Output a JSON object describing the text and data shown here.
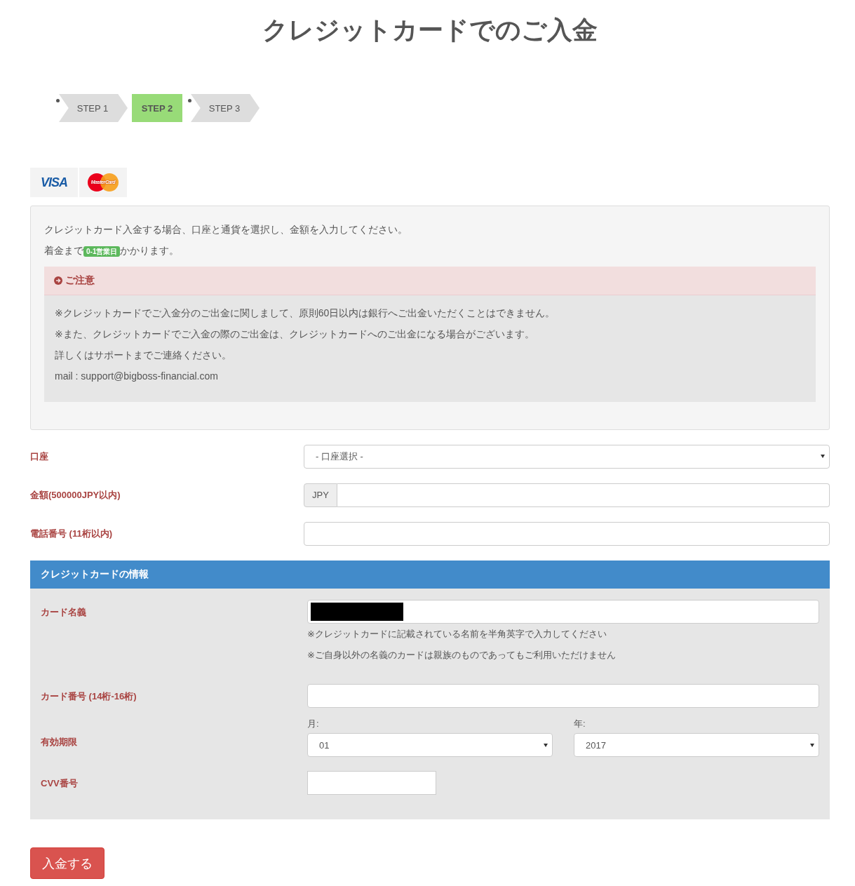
{
  "title": "クレジットカードでのご入金",
  "steps": [
    {
      "label": "STEP 1",
      "selected": false
    },
    {
      "label": "STEP 2",
      "selected": true
    },
    {
      "label": "STEP 3",
      "selected": false
    }
  ],
  "card_logos": [
    {
      "kind": "visa",
      "label": "VISA"
    },
    {
      "kind": "mastercard",
      "label": "MasterCard"
    }
  ],
  "info": {
    "lines": [
      "クレジットカード入金する場合、口座と通貨を選択し、金額を入力してください。"
    ],
    "arrival_prefix": "着金まで",
    "arrival_badge": "0-1営業日",
    "arrival_suffix": "かかります。",
    "notice": {
      "title": "ご注意",
      "lines": [
        "※クレジットカードでご入金分のご出金に関しまして、原則60日以内は銀行へご出金いただくことはできません。",
        "※また、クレジットカードでご入金の際のご出金は、クレジットカードへのご出金になる場合がございます。",
        "詳しくはサポートまでご連絡ください。",
        "mail : support@bigboss-financial.com"
      ]
    }
  },
  "fields": [
    {
      "kind": "select",
      "label": "口座",
      "value": "- 口座選択 -"
    },
    {
      "kind": "addon",
      "label": "金額(500000JPY以内)",
      "addon": "JPY"
    },
    {
      "kind": "text",
      "label": "電話番号 (11桁以内)"
    }
  ],
  "card_section": {
    "title": "クレジットカードの情報",
    "name": {
      "label": "カード名義",
      "redacted": true,
      "notes": [
        "※クレジットカードに記載されている名前を半角英字で入力してください",
        "※ご自身以外の名義のカードは親族のものであってもご利用いただけません"
      ]
    },
    "number": {
      "label": "カード番号 (14桁-16桁)"
    },
    "expiry": {
      "label": "有効期限",
      "month_label": "月:",
      "month": "01",
      "year_label": "年:",
      "year": "2017"
    },
    "cvv": {
      "label": "CVV番号"
    }
  },
  "submit": "入金する"
}
